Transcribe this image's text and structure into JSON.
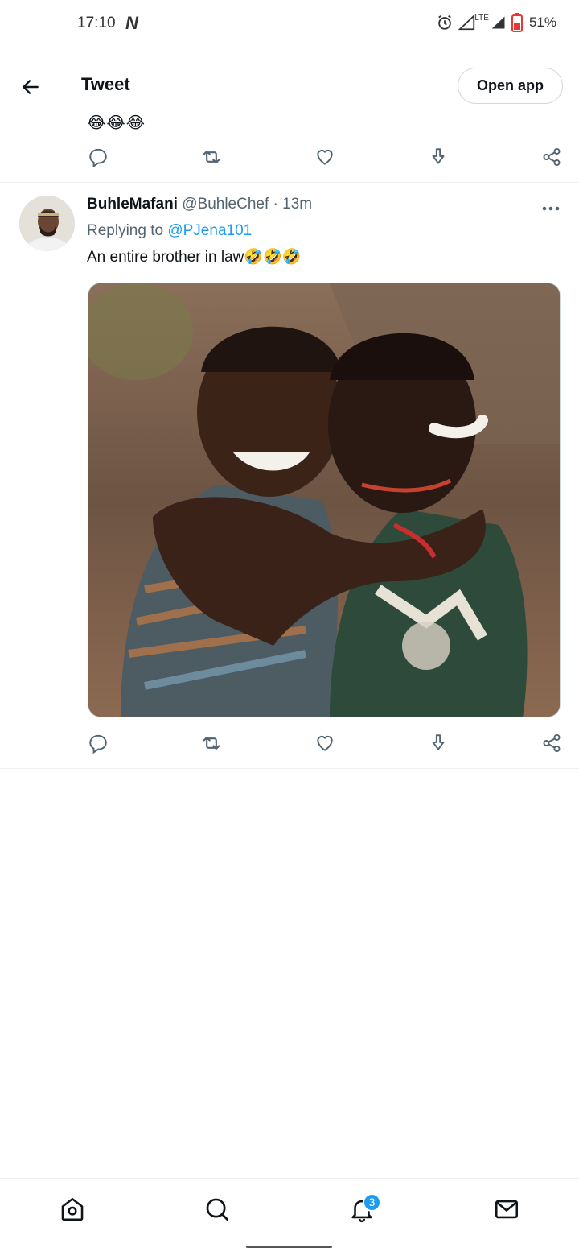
{
  "status_bar": {
    "time": "17:10",
    "network_logo": "N",
    "network_type": "LTE",
    "battery": "51%"
  },
  "header": {
    "title": "Tweet",
    "open_app_label": "Open app"
  },
  "previous_tweet": {
    "emoji": "😂😂😂"
  },
  "tweet": {
    "display_name": "BuhleMafani",
    "handle": "@BuhleChef",
    "separator": "·",
    "time": "13m",
    "replying_prefix": "Replying to",
    "replying_to": "@PJena101",
    "text": "An entire brother in law🤣🤣🤣"
  },
  "nav": {
    "notifications_badge": "3"
  },
  "colors": {
    "accent": "#1d9bf0",
    "text": "#0f1419",
    "muted": "#536471",
    "divider": "#eff3f4"
  },
  "icons": {
    "back": "arrow-left-icon",
    "reply": "reply-icon",
    "retweet": "retweet-icon",
    "like": "heart-icon",
    "download": "download-icon",
    "share": "share-icon",
    "more": "more-icon",
    "home": "home-icon",
    "search": "search-icon",
    "notifications": "bell-icon",
    "messages": "mail-icon"
  }
}
